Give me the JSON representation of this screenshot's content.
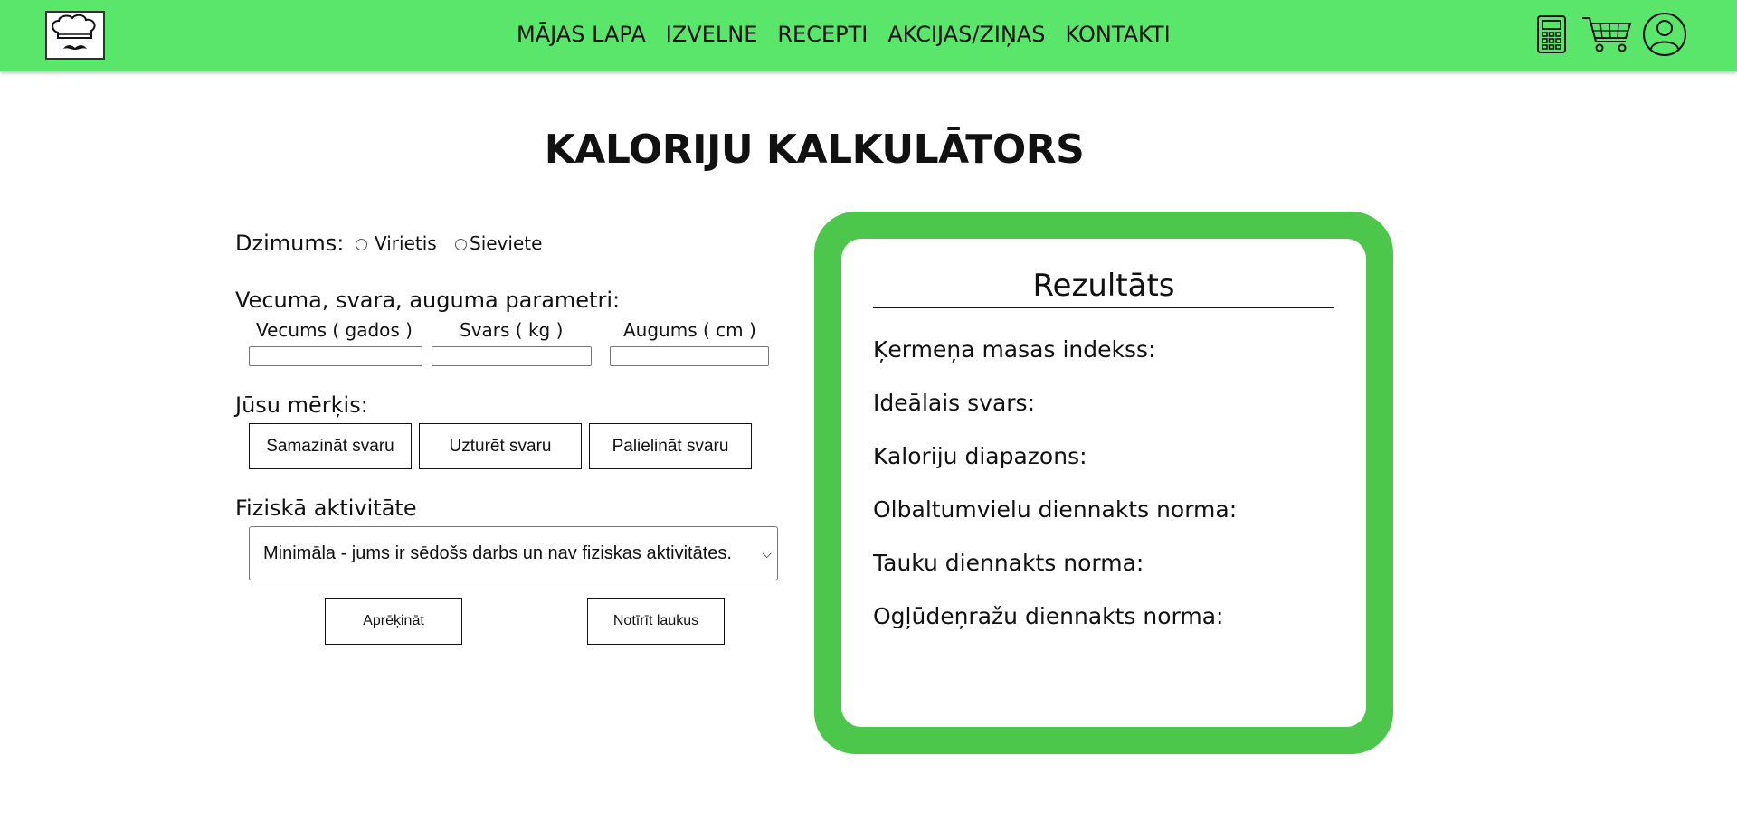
{
  "header": {
    "nav": [
      "MĀJAS LAPA",
      "IZVELNE",
      "RECEPTI",
      "AKCIJAS/ZIŅAS",
      "KONTAKTI"
    ],
    "icons": [
      "chef-logo-icon",
      "calculator-icon",
      "cart-icon",
      "user-icon"
    ],
    "background_color": "#5ae66a"
  },
  "title": "KALORIJU KALKULĀTORS",
  "form": {
    "gender_label": "Dzimums:",
    "gender_options": [
      "Virietis",
      "Sieviete"
    ],
    "params_label": "Vecuma, svara, auguma parametri:",
    "age_label": "Vecums ( gados )",
    "weight_label": "Svars ( kg )",
    "height_label": "Augums ( cm )",
    "age_value": "",
    "weight_value": "",
    "height_value": "",
    "goal_label": "Jūsu mērķis:",
    "goals": [
      "Samazināt svaru",
      "Uzturēt svaru",
      "Palielināt svaru"
    ],
    "activity_label": "Fiziskā aktivitāte",
    "activity_selected": "Minimāla - jums ir sēdošs darbs un nav fiziskas aktivitātes.",
    "calculate_label": "Aprēķināt",
    "clear_label": "Notīrīt laukus"
  },
  "results": {
    "title": "Rezultāts",
    "rows": [
      "Ķermeņa masas indekss:",
      "Ideālais svars:",
      "Kaloriju diapazons:",
      "Olbaltumvielu diennakts norma:",
      "Tauku diennakts norma:",
      "Ogļūdeņražu diennakts norma:"
    ],
    "frame_color": "#4cc74b"
  }
}
